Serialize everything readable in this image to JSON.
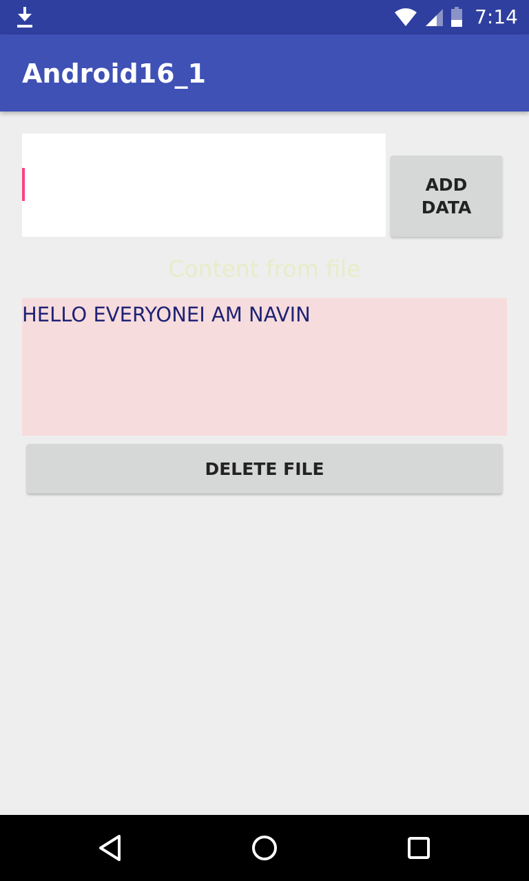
{
  "status_bar": {
    "time": "7:14",
    "icons": [
      "download-icon",
      "wifi-icon",
      "signal-icon",
      "battery-icon"
    ]
  },
  "app_bar": {
    "title": "Android16_1"
  },
  "input": {
    "value": "",
    "cursor_color": "#ff4081"
  },
  "buttons": {
    "add_data": "ADD DATA",
    "delete_file": "DELETE FILE"
  },
  "content": {
    "label": "Content from file",
    "text": "HELLO EVERYONEI AM NAVIN"
  },
  "colors": {
    "status_bar": "#2f3f9f",
    "app_bar": "#3f51b5",
    "background": "#eeeeee",
    "content_box": "#f7dcdd",
    "content_text": "#1f2375",
    "button": "#d6d7d7"
  },
  "nav_bar": {
    "icons": [
      "back-icon",
      "home-icon",
      "recents-icon"
    ]
  }
}
